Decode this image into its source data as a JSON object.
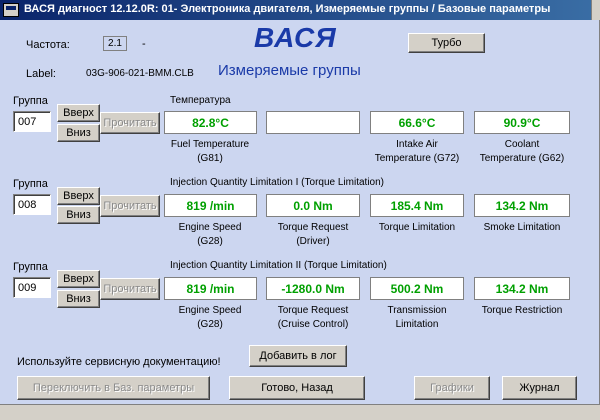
{
  "window": {
    "title": "ВАСЯ диагност 12.12.0R: 01- Электроника двигателя, Измеряемые группы / Базовые параметры"
  },
  "header": {
    "freq_label": "Частота:",
    "freq_value": "2.1",
    "freq_dash": "-",
    "label_label": "Label:",
    "label_value": "03G-906-021-BMM.CLB",
    "brand": "ВАСЯ",
    "subtitle": "Измеряемые группы",
    "turbo_button": "Турбо"
  },
  "groups": [
    {
      "group_label": "Группа",
      "group_number": "007",
      "up_label": "Вверх",
      "down_label": "Вниз",
      "read_label": "Прочитать",
      "title": "Температура",
      "fields": [
        {
          "value": "82.8°C",
          "label": "Fuel Temperature\n(G81)"
        },
        {
          "value": "",
          "label": ""
        },
        {
          "value": "66.6°C",
          "label": "Intake Air\nTemperature (G72)"
        },
        {
          "value": "90.9°C",
          "label": "Coolant\nTemperature (G62)"
        }
      ]
    },
    {
      "group_label": "Группа",
      "group_number": "008",
      "up_label": "Вверх",
      "down_label": "Вниз",
      "read_label": "Прочитать",
      "title": "Injection Quantity Limitation I (Torque Limitation)",
      "fields": [
        {
          "value": "819 /min",
          "label": "Engine Speed\n(G28)"
        },
        {
          "value": "0.0 Nm",
          "label": "Torque Request\n(Driver)"
        },
        {
          "value": "185.4 Nm",
          "label": "Torque Limitation"
        },
        {
          "value": "134.2 Nm",
          "label": "Smoke Limitation"
        }
      ]
    },
    {
      "group_label": "Группа",
      "group_number": "009",
      "up_label": "Вверх",
      "down_label": "Вниз",
      "read_label": "Прочитать",
      "title": "Injection Quantity Limitation II (Torque Limitation)",
      "fields": [
        {
          "value": "819 /min",
          "label": "Engine Speed\n(G28)"
        },
        {
          "value": "-1280.0 Nm",
          "label": "Torque Request\n(Cruise Control)"
        },
        {
          "value": "500.2 Nm",
          "label": "Transmission\nLimitation"
        },
        {
          "value": "134.2 Nm",
          "label": "Torque Restriction"
        }
      ]
    }
  ],
  "footer": {
    "hint": "Используйте сервисную документацию!",
    "add_log": "Добавить в лог",
    "switch_basic": "Переключить в Баз. параметры",
    "done_back": "Готово, Назад",
    "graphs": "Графики",
    "journal": "Журнал"
  }
}
